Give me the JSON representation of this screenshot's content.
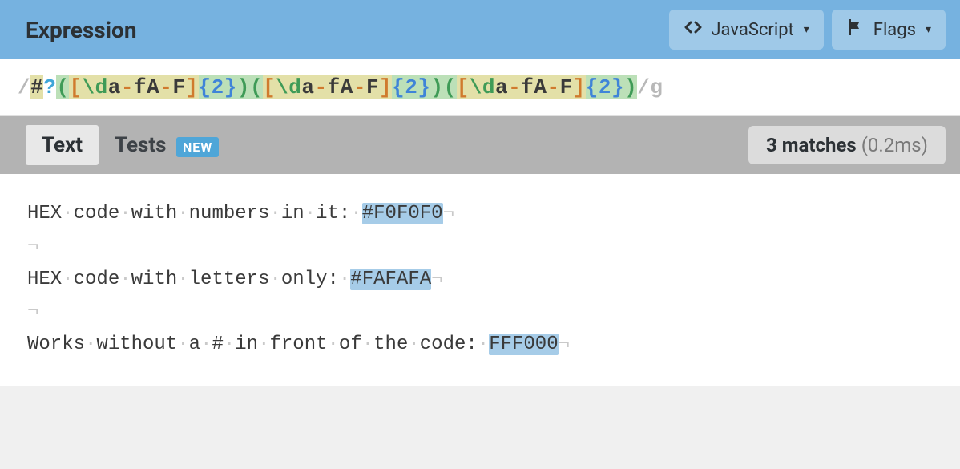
{
  "header": {
    "title": "Expression",
    "flavor_button": "JavaScript",
    "flags_button": "Flags"
  },
  "expression": {
    "open_delim": "/",
    "close_delim": "/",
    "flags": "g",
    "tokens": [
      {
        "t": "#",
        "cls": "tok-hash bg-yellow"
      },
      {
        "t": "?",
        "cls": "tok-qmark"
      },
      {
        "t": "(",
        "cls": "tok-paren bg-green"
      },
      {
        "t": "[",
        "cls": "tok-brack bg-yellow"
      },
      {
        "t": "\\d",
        "cls": "tok-esc bg-yellow"
      },
      {
        "t": "a",
        "cls": "tok-range bg-yellow"
      },
      {
        "t": "-",
        "cls": "tok-dash bg-yellow"
      },
      {
        "t": "f",
        "cls": "tok-range bg-yellow"
      },
      {
        "t": "A",
        "cls": "tok-range bg-yellow"
      },
      {
        "t": "-",
        "cls": "tok-dash bg-yellow"
      },
      {
        "t": "F",
        "cls": "tok-range bg-yellow"
      },
      {
        "t": "]",
        "cls": "tok-brack bg-yellow"
      },
      {
        "t": "{2}",
        "cls": "tok-quant bg-green"
      },
      {
        "t": ")",
        "cls": "tok-paren bg-green"
      },
      {
        "t": "(",
        "cls": "tok-paren bg-green"
      },
      {
        "t": "[",
        "cls": "tok-brack bg-yellow"
      },
      {
        "t": "\\d",
        "cls": "tok-esc bg-yellow"
      },
      {
        "t": "a",
        "cls": "tok-range bg-yellow"
      },
      {
        "t": "-",
        "cls": "tok-dash bg-yellow"
      },
      {
        "t": "f",
        "cls": "tok-range bg-yellow"
      },
      {
        "t": "A",
        "cls": "tok-range bg-yellow"
      },
      {
        "t": "-",
        "cls": "tok-dash bg-yellow"
      },
      {
        "t": "F",
        "cls": "tok-range bg-yellow"
      },
      {
        "t": "]",
        "cls": "tok-brack bg-yellow"
      },
      {
        "t": "{2}",
        "cls": "tok-quant bg-green"
      },
      {
        "t": ")",
        "cls": "tok-paren bg-green"
      },
      {
        "t": "(",
        "cls": "tok-paren bg-green"
      },
      {
        "t": "[",
        "cls": "tok-brack bg-yellow"
      },
      {
        "t": "\\d",
        "cls": "tok-esc bg-yellow"
      },
      {
        "t": "a",
        "cls": "tok-range bg-yellow"
      },
      {
        "t": "-",
        "cls": "tok-dash bg-yellow"
      },
      {
        "t": "f",
        "cls": "tok-range bg-yellow"
      },
      {
        "t": "A",
        "cls": "tok-range bg-yellow"
      },
      {
        "t": "-",
        "cls": "tok-dash bg-yellow"
      },
      {
        "t": "F",
        "cls": "tok-range bg-yellow"
      },
      {
        "t": "]",
        "cls": "tok-brack bg-yellow"
      },
      {
        "t": "{2}",
        "cls": "tok-quant bg-green"
      },
      {
        "t": ")",
        "cls": "tok-paren bg-green"
      }
    ]
  },
  "toolbar": {
    "tab_text": "Text",
    "tab_tests": "Tests",
    "badge_new": "NEW",
    "match_count": "3 matches",
    "match_time": "(0.2ms)"
  },
  "test_text": {
    "lines": [
      {
        "segments": [
          {
            "text": "HEX",
            "type": "word"
          },
          {
            "text": "code",
            "type": "word"
          },
          {
            "text": "with",
            "type": "word"
          },
          {
            "text": "numbers",
            "type": "word"
          },
          {
            "text": "in",
            "type": "word"
          },
          {
            "text": "it:",
            "type": "word"
          },
          {
            "text": "#F0F0F0",
            "type": "match"
          }
        ]
      },
      {
        "segments": []
      },
      {
        "segments": [
          {
            "text": "HEX",
            "type": "word"
          },
          {
            "text": "code",
            "type": "word"
          },
          {
            "text": "with",
            "type": "word"
          },
          {
            "text": "letters",
            "type": "word"
          },
          {
            "text": "only:",
            "type": "word"
          },
          {
            "text": "#FAFAFA",
            "type": "match"
          }
        ]
      },
      {
        "segments": []
      },
      {
        "segments": [
          {
            "text": "Works",
            "type": "word"
          },
          {
            "text": "without",
            "type": "word"
          },
          {
            "text": "a",
            "type": "word"
          },
          {
            "text": "#",
            "type": "word"
          },
          {
            "text": "in",
            "type": "word"
          },
          {
            "text": "front",
            "type": "word"
          },
          {
            "text": "of",
            "type": "word"
          },
          {
            "text": "the",
            "type": "word"
          },
          {
            "text": "code:",
            "type": "word"
          },
          {
            "text": "FFF000",
            "type": "match"
          }
        ]
      }
    ]
  },
  "glyphs": {
    "space_dot": "·",
    "line_end": "¬"
  }
}
